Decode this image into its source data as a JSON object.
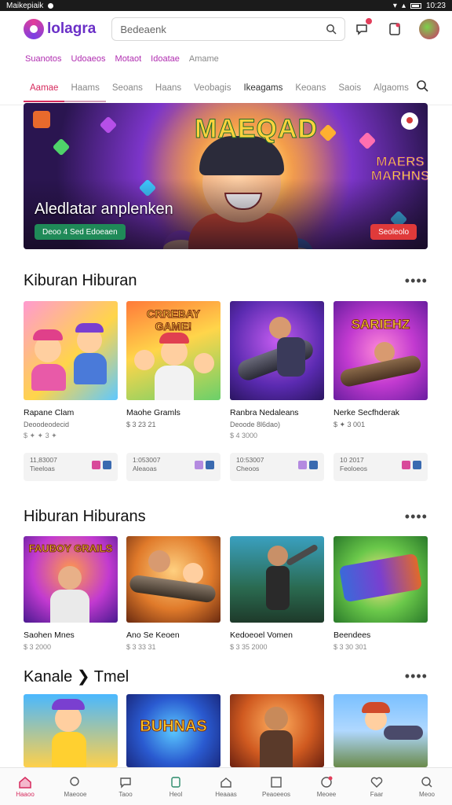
{
  "status_bar": {
    "left_text": "Maikepiaik",
    "time": "10:23"
  },
  "header": {
    "logo_text": "lolagra",
    "search_value": "Bedeaenk"
  },
  "category_links": [
    "Suanotos",
    "Udoaeos",
    "Motaot",
    "Idoatae",
    "Amame"
  ],
  "tabs": [
    "Aamae",
    "Haams",
    "Seoans",
    "Haans",
    "Veobagis",
    "Ikeagams",
    "Keoans",
    "Saois",
    "Algaoms"
  ],
  "hero": {
    "art_title": "MAEQAD",
    "art_subtitle": "MAERS MARHNS",
    "caption": "Aledlatar anplenken",
    "left_button": "Deoo 4 Sed Edoeaen",
    "right_button": "Seoleolo"
  },
  "section1": {
    "title": "Kiburan Hiburan",
    "more": "••••",
    "cards": [
      {
        "title": "Rapane Clam",
        "sub": "Deoodeodecid",
        "meta": "$ ✦ ✦ 3 ✦"
      },
      {
        "title": "Maohe Gramls",
        "sub": "$ 3 23 21",
        "meta": ""
      },
      {
        "title": "Ranbra Nedaleans",
        "sub": "Deoode 8l6dao)",
        "meta": "$ 4 3000"
      },
      {
        "title": "Nerke Secfhderak",
        "sub": "$ ✦ 3 001",
        "meta": ""
      }
    ],
    "card_art": [
      "",
      "CRREBAY GAME!",
      "",
      "SARIEHZ"
    ],
    "prices": [
      {
        "line1": "11,83007",
        "line2": "Tieeloas"
      },
      {
        "line1": "1:053007",
        "line2": "Aleaoas"
      },
      {
        "line1": "10:53007",
        "line2": "Cheoos"
      },
      {
        "line1": "10 2017",
        "line2": "Feoloeos"
      }
    ]
  },
  "section2": {
    "title": "Hiburan Hiburans",
    "more": "••••",
    "cards": [
      {
        "title": "Saohen Mnes",
        "sub": "$ 3 2000"
      },
      {
        "title": "Ano Se Keoen",
        "sub": "$ 3 33 31"
      },
      {
        "title": "Kedoeoel Vomen",
        "sub": "$ 3 35 2000"
      },
      {
        "title": "Beendees",
        "sub": "$ 3 30 301"
      }
    ],
    "card_art": [
      "FAUBOY GRAILS",
      "",
      "",
      ""
    ]
  },
  "section3": {
    "title": "Kanale ❯ Tmel",
    "more": "••••",
    "card_art": [
      "",
      "BUHNAS",
      "",
      ""
    ]
  },
  "bottom_nav": [
    "Haaoo",
    "Maeooe",
    "Taoo",
    "Heol",
    "Heaaas",
    "Peaoeeos",
    "Meoee",
    "Faar",
    "Meoo"
  ],
  "colors": {
    "accent": "#d62b5e",
    "brand": "#6a2fc7",
    "link": "#b02db0"
  }
}
